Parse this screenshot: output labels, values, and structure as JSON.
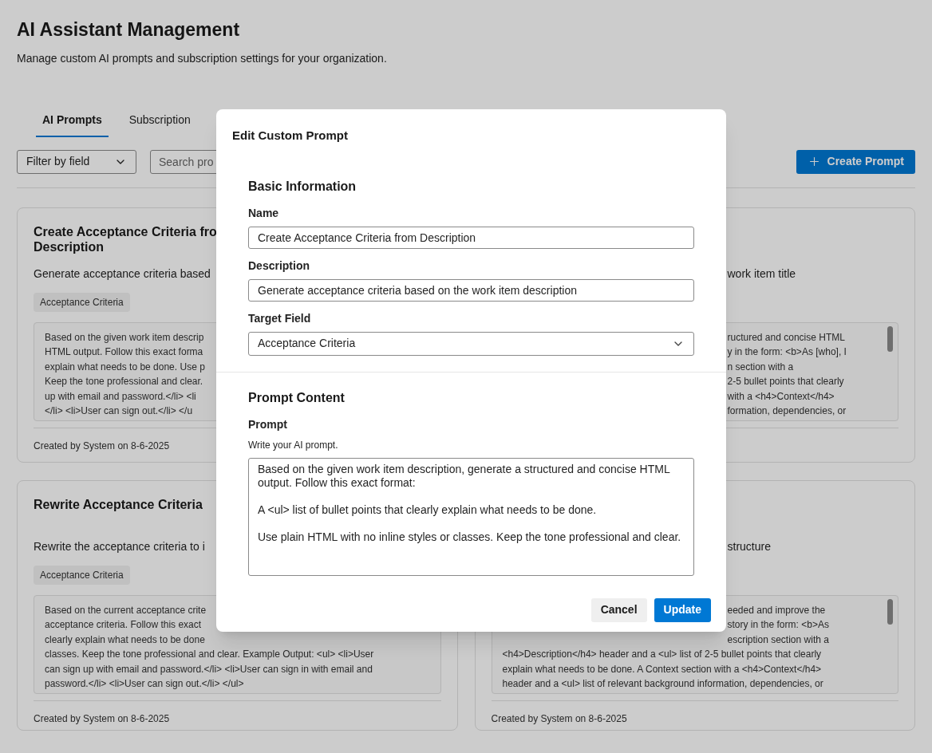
{
  "page": {
    "title": "AI Assistant Management",
    "subtitle": "Manage custom AI prompts and subscription settings for your organization."
  },
  "tabs": [
    {
      "label": "AI Prompts",
      "selected": true
    },
    {
      "label": "Subscription",
      "selected": false
    }
  ],
  "toolbar": {
    "filter": {
      "value": "Filter by field"
    },
    "search": {
      "placeholder": "Search pro"
    },
    "create_button": "Create Prompt"
  },
  "cards": [
    {
      "title_lines": [
        "Create Acceptance Criteria fro",
        "Description"
      ],
      "description": "Generate acceptance criteria based",
      "tag": "Acceptance Criteria",
      "preview_lines": [
        "Based on the given work item descrip",
        "HTML output. Follow this exact forma",
        "explain what needs to be done. Use p",
        "Keep the tone professional and clear.",
        "up with email and password.</li> <li",
        "</li> <li>User can sign out.</li> </u"
      ],
      "footer": "Created by System on 8-6-2025"
    },
    {
      "description": "work item title",
      "preview_lines": [
        {
          "text": "ructured and concise HTML",
          "clipped": true
        },
        {
          "text": "y in the form: <b>As [who], I",
          "clipped": true
        },
        {
          "text": "n section with a",
          "clipped": true
        },
        {
          "text": "2-5 bullet points that clearly",
          "clipped": true
        },
        {
          "text": "with a <h4>Context</h4>",
          "clipped": true
        },
        {
          "text": "formation, dependencies, or",
          "clipped": true
        }
      ]
    },
    {
      "title_lines": [
        "Rewrite Acceptance Criteria"
      ],
      "description": "Rewrite the acceptance criteria to i",
      "tag": "Acceptance Criteria",
      "preview_lines": [
        "Based on the current acceptance crite",
        "acceptance criteria. Follow this exact",
        "clearly explain what needs to be done",
        "classes. Keep the tone professional and clear. Example Output: <ul> <li>User",
        "can sign up with email and password.</li> <li>User can sign in with email and",
        "password.</li> <li>User can sign out.</li> </ul>"
      ],
      "footer": "Created by System on 8-6-2025"
    },
    {
      "description": "structure",
      "preview_lines": [
        {
          "text": "eeded and improve the",
          "clipped": true
        },
        {
          "text": "story in the form: <b>As",
          "clipped": true
        },
        {
          "text": "escription section with a",
          "clipped": true
        },
        {
          "text": "<h4>Description</h4> header and a <ul> list of 2-5 bullet points that clearly",
          "clipped": false
        },
        {
          "text": "explain what needs to be done. A Context section with a <h4>Context</h4>",
          "clipped": false
        },
        {
          "text": "header and a <ul> list of relevant background information, dependencies, or",
          "clipped": false
        }
      ],
      "footer": "Created by System on 8-6-2025"
    }
  ],
  "modal": {
    "title": "Edit Custom Prompt",
    "sections": [
      {
        "heading": "Basic Information",
        "fields": [
          {
            "kind": "text",
            "label": "Name",
            "value": "Create Acceptance Criteria from Description"
          },
          {
            "kind": "text",
            "label": "Description",
            "value": "Generate acceptance criteria based on the work item description"
          },
          {
            "kind": "select",
            "label": "Target Field",
            "value": "Acceptance Criteria"
          }
        ]
      },
      {
        "heading": "Prompt Content",
        "fields": [
          {
            "kind": "textarea",
            "label": "Prompt",
            "hint": "Write your AI prompt.",
            "value": "Based on the given work item description, generate a structured and concise HTML output. Follow this exact format:\n\nA <ul> list of bullet points that clearly explain what needs to be done.\n\nUse plain HTML with no inline styles or classes. Keep the tone professional and clear."
          }
        ]
      }
    ],
    "buttons": [
      {
        "label": "Cancel",
        "kind": "secondary"
      },
      {
        "label": "Update",
        "kind": "primary"
      }
    ]
  }
}
